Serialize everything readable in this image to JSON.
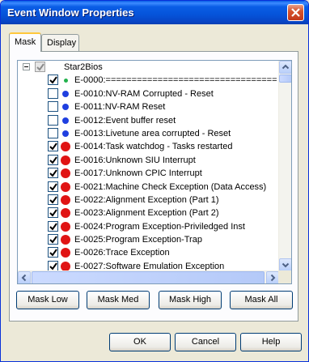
{
  "window": {
    "title": "Event Window Properties",
    "close_label": "✕"
  },
  "tabs": [
    {
      "label": "Mask",
      "active": true
    },
    {
      "label": "Display",
      "active": false
    }
  ],
  "tree": {
    "root": {
      "label": "Star2Bios",
      "expander": "−",
      "checked": true
    },
    "items": [
      {
        "label": "E-0000:=================================",
        "checked": true,
        "color": "#22b14c",
        "size": "small"
      },
      {
        "label": "E-0010:NV-RAM Corrupted - Reset",
        "checked": false,
        "color": "#1f3fe0",
        "size": "medium"
      },
      {
        "label": "E-0011:NV-RAM Reset",
        "checked": false,
        "color": "#1f3fe0",
        "size": "medium"
      },
      {
        "label": "E-0012:Event buffer reset",
        "checked": false,
        "color": "#1f3fe0",
        "size": "medium"
      },
      {
        "label": "E-0013:Livetune area corrupted - Reset",
        "checked": false,
        "color": "#1f3fe0",
        "size": "medium"
      },
      {
        "label": "E-0014:Task watchdog - Tasks restarted",
        "checked": true,
        "color": "#e01414",
        "size": "large"
      },
      {
        "label": "E-0016:Unknown SIU Interrupt",
        "checked": true,
        "color": "#e01414",
        "size": "large"
      },
      {
        "label": "E-0017:Unknown CPIC Interrupt",
        "checked": true,
        "color": "#e01414",
        "size": "large"
      },
      {
        "label": "E-0021:Machine Check Exception (Data Access)",
        "checked": true,
        "color": "#e01414",
        "size": "large"
      },
      {
        "label": "E-0022:Alignment Exception (Part 1)",
        "checked": true,
        "color": "#e01414",
        "size": "large"
      },
      {
        "label": "E-0023:Alignment Exception (Part 2)",
        "checked": true,
        "color": "#e01414",
        "size": "large"
      },
      {
        "label": "E-0024:Program Exception-Priviledged Inst",
        "checked": true,
        "color": "#e01414",
        "size": "large"
      },
      {
        "label": "E-0025:Program Exception-Trap",
        "checked": true,
        "color": "#e01414",
        "size": "large"
      },
      {
        "label": "E-0026:Trace Exception",
        "checked": true,
        "color": "#e01414",
        "size": "large"
      },
      {
        "label": "E-0027:Software Emulation Exception",
        "checked": true,
        "color": "#e01414",
        "size": "large"
      }
    ]
  },
  "mask_buttons": [
    "Mask Low",
    "Mask Med",
    "Mask High",
    "Mask All"
  ],
  "dialog_buttons": {
    "ok": "OK",
    "cancel": "Cancel",
    "help": "Help"
  }
}
